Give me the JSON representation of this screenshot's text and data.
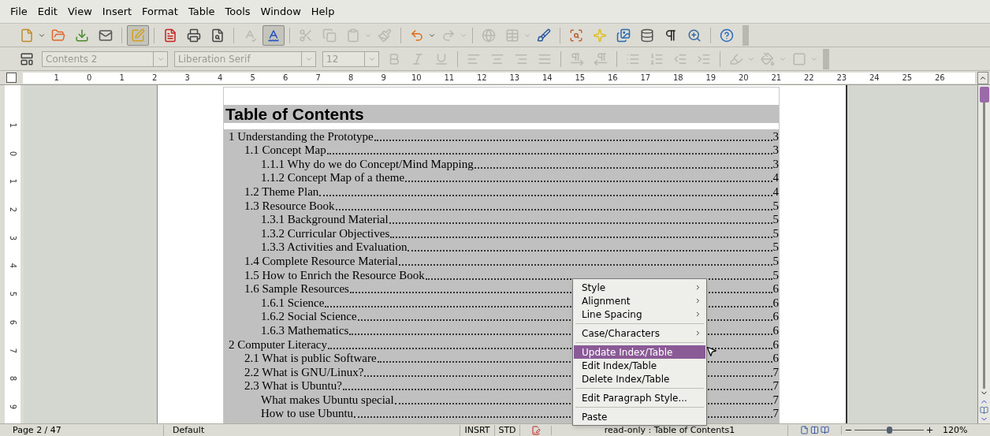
{
  "menu_bar": [
    "File",
    "Edit",
    "View",
    "Insert",
    "Format",
    "Table",
    "Tools",
    "Window",
    "Help"
  ],
  "standard_toolbar": [
    {
      "kind": "button",
      "disabled": false,
      "pressed": false
    },
    {
      "kind": "button",
      "disabled": false,
      "pressed": false
    },
    {
      "kind": "button",
      "disabled": false,
      "pressed": false
    },
    {
      "kind": "button",
      "disabled": false,
      "pressed": false
    },
    {
      "kind": "separator"
    },
    {
      "kind": "button",
      "disabled": false,
      "pressed": true
    },
    {
      "kind": "separator"
    },
    {
      "kind": "button",
      "disabled": false,
      "pressed": false
    },
    {
      "kind": "button",
      "disabled": false,
      "pressed": false
    },
    {
      "kind": "button",
      "disabled": false,
      "pressed": false
    },
    {
      "kind": "separator"
    },
    {
      "kind": "button",
      "disabled": true,
      "pressed": false
    },
    {
      "kind": "button",
      "disabled": false,
      "pressed": true
    },
    {
      "kind": "separator"
    },
    {
      "kind": "button",
      "disabled": true,
      "pressed": false
    },
    {
      "kind": "button",
      "disabled": true,
      "pressed": false
    },
    {
      "kind": "button",
      "disabled": true,
      "pressed": false
    },
    {
      "kind": "button",
      "disabled": true,
      "pressed": false
    },
    {
      "kind": "separator"
    },
    {
      "kind": "button",
      "disabled": false,
      "pressed": false
    },
    {
      "kind": "button",
      "disabled": true,
      "pressed": false
    },
    {
      "kind": "separator"
    },
    {
      "kind": "button",
      "disabled": true,
      "pressed": false
    },
    {
      "kind": "button",
      "disabled": true,
      "pressed": false
    },
    {
      "kind": "button",
      "disabled": false,
      "pressed": false
    },
    {
      "kind": "separator"
    },
    {
      "kind": "button",
      "disabled": false,
      "pressed": false
    },
    {
      "kind": "button",
      "disabled": false,
      "pressed": false
    },
    {
      "kind": "button",
      "disabled": false,
      "pressed": false
    },
    {
      "kind": "button",
      "disabled": false,
      "pressed": false
    },
    {
      "kind": "button",
      "disabled": false,
      "pressed": false
    },
    {
      "kind": "button",
      "disabled": false,
      "pressed": false
    },
    {
      "kind": "separator"
    },
    {
      "kind": "button",
      "disabled": false,
      "pressed": false
    }
  ],
  "formatting_toolbar": [
    {
      "kind": "button",
      "disabled": false,
      "pressed": false
    },
    {
      "kind": "combo",
      "value": "Contents 2",
      "disabled": true
    },
    {
      "kind": "combo",
      "value": "Liberation Serif",
      "disabled": true
    },
    {
      "kind": "combo",
      "value": "12",
      "disabled": true
    },
    {
      "kind": "button",
      "disabled": true,
      "pressed": false
    },
    {
      "kind": "button",
      "disabled": true,
      "pressed": false
    },
    {
      "kind": "button",
      "disabled": true,
      "pressed": false
    },
    {
      "kind": "separator"
    },
    {
      "kind": "button",
      "disabled": true,
      "pressed": false
    },
    {
      "kind": "button",
      "disabled": true,
      "pressed": false
    },
    {
      "kind": "button",
      "disabled": true,
      "pressed": false
    },
    {
      "kind": "button",
      "disabled": true,
      "pressed": false
    },
    {
      "kind": "separator"
    },
    {
      "kind": "button",
      "disabled": true,
      "pressed": false
    },
    {
      "kind": "button",
      "disabled": true,
      "pressed": false
    },
    {
      "kind": "separator"
    },
    {
      "kind": "button",
      "disabled": true,
      "pressed": false
    },
    {
      "kind": "button",
      "disabled": true,
      "pressed": false
    },
    {
      "kind": "button",
      "disabled": true,
      "pressed": false
    },
    {
      "kind": "button",
      "disabled": true,
      "pressed": false
    },
    {
      "kind": "separator"
    },
    {
      "kind": "button",
      "disabled": true,
      "pressed": false
    },
    {
      "kind": "button",
      "disabled": true,
      "pressed": false
    },
    {
      "kind": "button",
      "disabled": true,
      "pressed": false
    }
  ],
  "horizontal_ruler": [
    "1",
    "0",
    "1",
    "2",
    "3",
    "4",
    "5",
    "6",
    "7",
    "8",
    "9",
    "10",
    "11",
    "12",
    "13",
    "14",
    "15",
    "16",
    "17",
    "18",
    "19",
    "20",
    "21",
    "22",
    "23",
    "24",
    "25",
    "26"
  ],
  "vertical_ruler": [
    "1",
    "0",
    "1",
    "2",
    "3",
    "4",
    "5",
    "6",
    "7",
    "8",
    "9"
  ],
  "document": {
    "heading": "Table of Contents",
    "entries": [
      {
        "title": "1 Understanding the Prototype",
        "page": "3",
        "children": [
          {
            "title": "1.1 Concept Map",
            "page": "3",
            "children": [
              {
                "title": "1.1.1 Why do we do Concept/Mind Mapping",
                "page": "3"
              },
              {
                "title": "1.1.2 Concept Map of a theme",
                "page": "4"
              }
            ]
          },
          {
            "title": "1.2 Theme Plan",
            "page": "4"
          },
          {
            "title": "1.3 Resource Book",
            "page": "5",
            "children": [
              {
                "title": "1.3.1 Background Material",
                "page": "5"
              },
              {
                "title": "1.3.2 Curricular Objectives",
                "page": "5"
              },
              {
                "title": "1.3.3 Activities and Evaluation",
                "page": "5"
              }
            ]
          },
          {
            "title": "1.4 Complete Resource Material",
            "page": "5"
          },
          {
            "title": "1.5 How to Enrich the Resource Book",
            "page": "5"
          },
          {
            "title": "1.6 Sample Resources",
            "page": "6",
            "children": [
              {
                "title": "1.6.1 Science",
                "page": "6"
              },
              {
                "title": "1.6.2 Social Science",
                "page": "6"
              },
              {
                "title": "1.6.3 Mathematics",
                "page": "6"
              }
            ]
          }
        ]
      },
      {
        "title": "2 Computer Literacy",
        "page": "6",
        "children": [
          {
            "title": "2.1 What is public Software",
            "page": "6"
          },
          {
            "title": "2.2 What is GNU/Linux?",
            "page": "7"
          },
          {
            "title": "2.3 What is Ubuntu?",
            "page": "7",
            "children": [
              {
                "title": "What makes Ubuntu special",
                "page": "7"
              },
              {
                "title": "How to use Ubuntu",
                "page": "7"
              }
            ]
          }
        ]
      }
    ]
  },
  "context_menu": [
    {
      "kind": "submenu",
      "label": "Style",
      "selected": false
    },
    {
      "kind": "submenu",
      "label": "Alignment",
      "selected": false
    },
    {
      "kind": "submenu",
      "label": "Line Spacing",
      "selected": false
    },
    {
      "kind": "separator"
    },
    {
      "kind": "submenu",
      "label": "Case/Characters",
      "selected": false
    },
    {
      "kind": "separator"
    },
    {
      "kind": "item",
      "label": "Update Index/Table",
      "selected": true
    },
    {
      "kind": "item",
      "label": "Edit Index/Table",
      "selected": false
    },
    {
      "kind": "item",
      "label": "Delete Index/Table",
      "selected": false
    },
    {
      "kind": "separator"
    },
    {
      "kind": "item",
      "label": "Edit Paragraph Style...",
      "selected": false
    },
    {
      "kind": "separator"
    },
    {
      "kind": "item",
      "label": "Paste",
      "selected": false
    }
  ],
  "status_bar": {
    "page": "Page 2 / 47",
    "page_style": "Default",
    "insert_mode": "INSRT",
    "selection_mode": "STD",
    "document_status": "read-only : Table of Contents1",
    "zoom": {
      "level": 0.5,
      "reading": "120%"
    }
  }
}
